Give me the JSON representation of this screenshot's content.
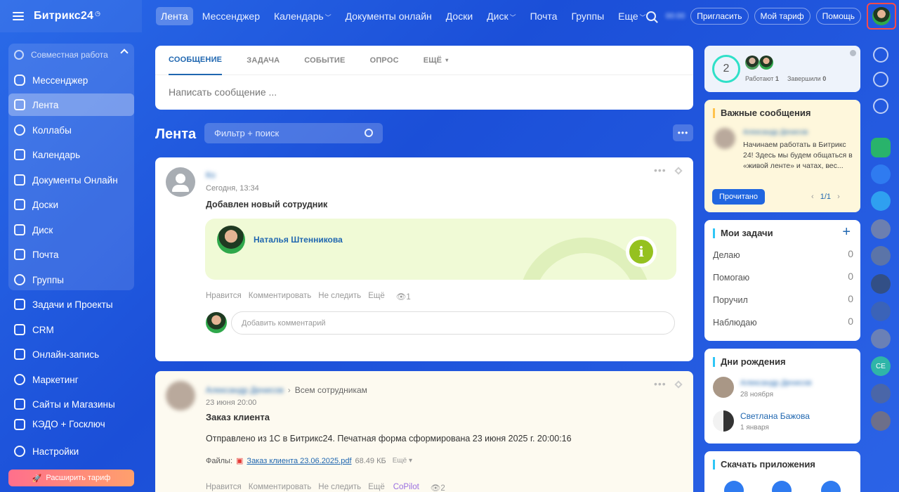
{
  "brand": {
    "logo": "Битрикс24"
  },
  "topnav": [
    {
      "label": "Лента",
      "active": true,
      "caret": false
    },
    {
      "label": "Мессенджер",
      "active": false,
      "caret": false
    },
    {
      "label": "Календарь",
      "active": false,
      "caret": true
    },
    {
      "label": "Документы онлайн",
      "active": false,
      "caret": false
    },
    {
      "label": "Доски",
      "active": false,
      "caret": false
    },
    {
      "label": "Диск",
      "active": false,
      "caret": true
    },
    {
      "label": "Почта",
      "active": false,
      "caret": false
    },
    {
      "label": "Группы",
      "active": false,
      "caret": false
    },
    {
      "label": "Еще",
      "active": false,
      "caret": true
    }
  ],
  "topright": {
    "clock": "00:00",
    "invite": "Пригласить",
    "tariff": "Мой тариф",
    "help": "Помощь"
  },
  "sidebar": {
    "group_header": "Совместная работа",
    "items": [
      {
        "label": "Мессенджер",
        "active": false
      },
      {
        "label": "Лента",
        "active": true
      },
      {
        "label": "Коллабы",
        "active": false
      },
      {
        "label": "Календарь",
        "active": false
      },
      {
        "label": "Документы Онлайн",
        "active": false
      },
      {
        "label": "Доски",
        "active": false
      },
      {
        "label": "Диск",
        "active": false
      },
      {
        "label": "Почта",
        "active": false
      },
      {
        "label": "Группы",
        "active": false
      },
      {
        "label": "Задачи и Проекты",
        "active": false
      },
      {
        "label": "CRM",
        "active": false
      },
      {
        "label": "Онлайн-запись",
        "active": false
      },
      {
        "label": "Маркетинг",
        "active": false
      },
      {
        "label": "Сайты и Магазины",
        "active": false
      },
      {
        "label": "КЭДО + Госключ",
        "active": false
      }
    ],
    "settings": "Настройки",
    "upgrade": "Расширить тариф"
  },
  "composer": {
    "tabs": [
      "СООБЩЕНИЕ",
      "ЗАДАЧА",
      "СОБЫТИЕ",
      "ОПРОС",
      "ЕЩЁ"
    ],
    "placeholder": "Написать сообщение ..."
  },
  "feed": {
    "title": "Лента",
    "filter_placeholder": "Фильтр + поиск",
    "more": "•••"
  },
  "post1": {
    "author": "Ко",
    "time": "Сегодня, 13:34",
    "title": "Добавлен новый сотрудник",
    "employee": "Наталья Штенникова",
    "actions": [
      "Нравится",
      "Комментировать",
      "Не следить",
      "Ещё"
    ],
    "views": "1",
    "comment_placeholder": "Добавить комментарий"
  },
  "post2": {
    "author": "Александр Денисов",
    "recipients": "Всем сотрудникам",
    "time": "23 июня 20:00",
    "title": "Заказ клиента",
    "body": "Отправлено из 1С в Битрикс24. Печатная форма сформирована 23 июня 2025 г. 20:00:16",
    "files_label": "Файлы:",
    "file_name": "Заказ клиента 23.06.2025.pdf",
    "file_size": "68.49 КБ",
    "file_more": "Ещё",
    "actions": [
      "Нравится",
      "Комментировать",
      "Не следить",
      "Ещё"
    ],
    "copilot": "CoPilot",
    "views": "2"
  },
  "widget_work": {
    "count": "2",
    "working_label": "Работают",
    "working": "1",
    "finished_label": "Завершили",
    "finished": "0"
  },
  "important": {
    "title": "Важные сообщения",
    "author": "Александр Денисов",
    "text": "Начинаем работать в Битрикс 24! Здесь мы будем общаться в «живой ленте» и чатах, вес...",
    "read_button": "Прочитано",
    "pager": "1/1"
  },
  "tasks": {
    "title": "Мои задачи",
    "rows": [
      {
        "label": "Делаю",
        "count": "0"
      },
      {
        "label": "Помогаю",
        "count": "0"
      },
      {
        "label": "Поручил",
        "count": "0"
      },
      {
        "label": "Наблюдаю",
        "count": "0"
      }
    ]
  },
  "birthdays": {
    "title": "Дни рождения",
    "items": [
      {
        "name": "Александр Денисов",
        "date": "28 ноября"
      },
      {
        "name": "Светлана Бажова",
        "date": "1 января"
      }
    ]
  },
  "apps": {
    "title": "Скачать приложения"
  },
  "rail": {
    "initials": "СЕ"
  },
  "colors": {
    "accent": "#2067b0",
    "bg": "#1b4fd8",
    "green": "#95c11f"
  }
}
